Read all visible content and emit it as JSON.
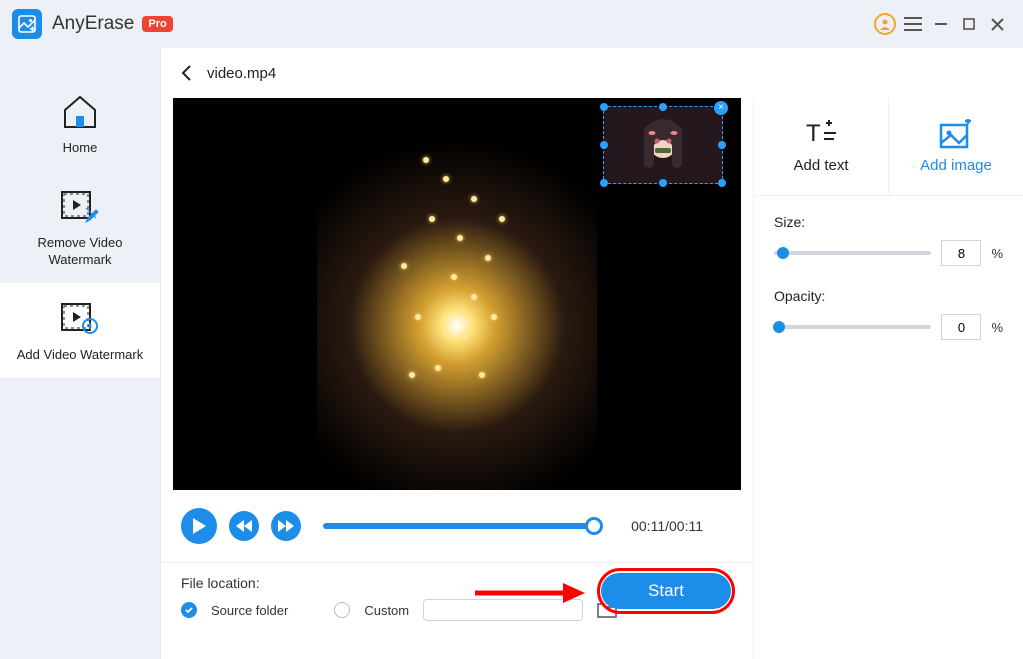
{
  "app": {
    "name": "AnyErase",
    "badge": "Pro"
  },
  "sidebar": {
    "items": [
      {
        "label": "Home"
      },
      {
        "label": "Remove Video Watermark"
      },
      {
        "label": "Add Video Watermark"
      }
    ],
    "active_index": 2
  },
  "breadcrumb": {
    "filename": "video.mp4"
  },
  "player": {
    "current": "00:11",
    "duration": "00:11"
  },
  "file_location": {
    "title": "File location:",
    "source_label": "Source folder",
    "custom_label": "Custom",
    "selected": "source"
  },
  "watermark_tabs": {
    "add_text": "Add text",
    "add_image": "Add image",
    "active": "add_image"
  },
  "controls": {
    "size_label": "Size:",
    "size_value": "8",
    "opacity_label": "Opacity:",
    "opacity_value": "0"
  },
  "start_button": "Start",
  "colors": {
    "accent": "#1c8de8",
    "callout": "#f00"
  }
}
